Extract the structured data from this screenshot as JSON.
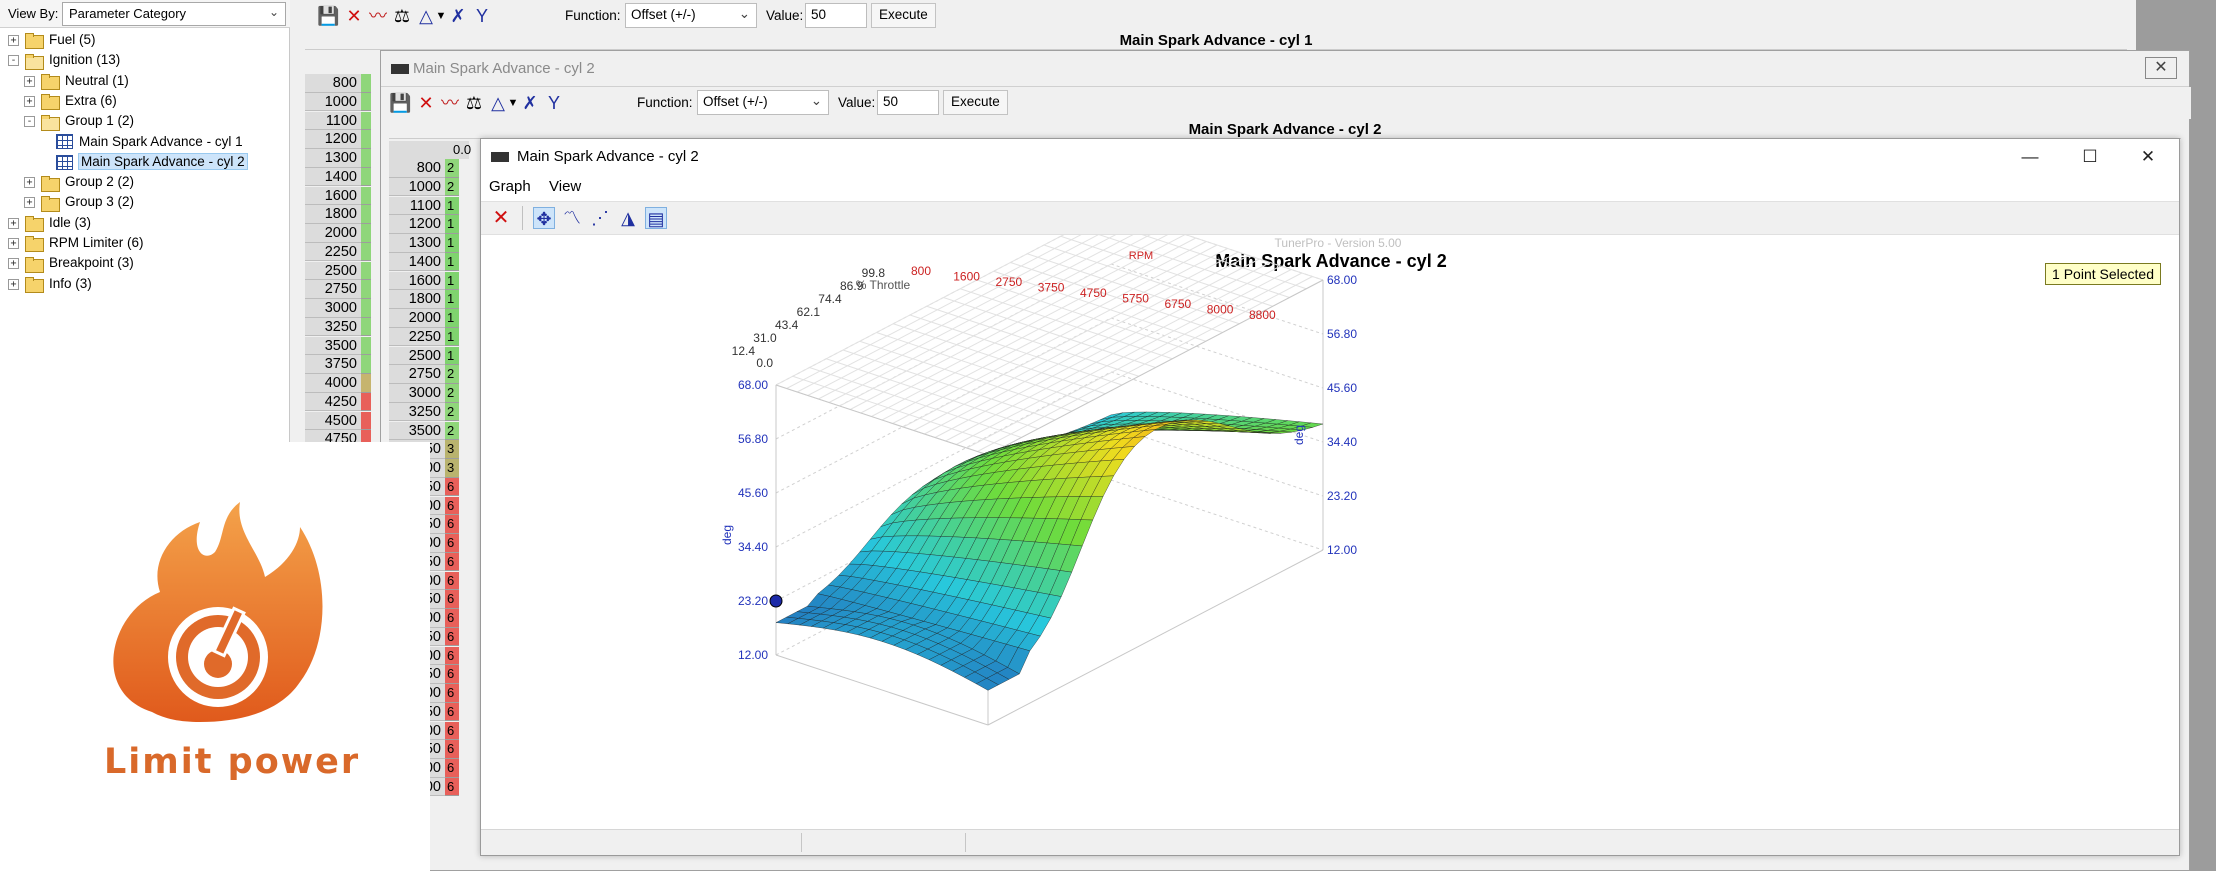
{
  "sidebar": {
    "view_by_label": "View By:",
    "view_by_value": "Parameter Category",
    "tree": [
      {
        "label": "Fuel (5)",
        "level": 0,
        "exp": "+",
        "icon": "folder"
      },
      {
        "label": "Ignition (13)",
        "level": 0,
        "exp": "-",
        "icon": "folder-open"
      },
      {
        "label": "Neutral (1)",
        "level": 1,
        "exp": "+",
        "icon": "folder"
      },
      {
        "label": "Extra (6)",
        "level": 1,
        "exp": "+",
        "icon": "folder"
      },
      {
        "label": "Group 1 (2)",
        "level": 1,
        "exp": "-",
        "icon": "folder-open"
      },
      {
        "label": "Main Spark Advance - cyl 1",
        "level": 2,
        "exp": "",
        "icon": "table"
      },
      {
        "label": "Main Spark Advance - cyl 2",
        "level": 2,
        "exp": "",
        "icon": "table",
        "selected": true
      },
      {
        "label": "Group 2 (2)",
        "level": 1,
        "exp": "+",
        "icon": "folder"
      },
      {
        "label": "Group 3 (2)",
        "level": 1,
        "exp": "+",
        "icon": "folder"
      },
      {
        "label": "Idle (3)",
        "level": 0,
        "exp": "+",
        "icon": "folder"
      },
      {
        "label": "RPM Limiter (6)",
        "level": 0,
        "exp": "+",
        "icon": "folder"
      },
      {
        "label": "Breakpoint (3)",
        "level": 0,
        "exp": "+",
        "icon": "folder"
      },
      {
        "label": "Info (3)",
        "level": 0,
        "exp": "+",
        "icon": "folder"
      }
    ]
  },
  "logo": {
    "text": "Limit power",
    "color": "#d9692a"
  },
  "table_window_1": {
    "title": "Main Spark Advance - cyl 1",
    "function_label": "Function:",
    "function_value": "Offset (+/-)",
    "value_label": "Value:",
    "value": "50",
    "execute_label": "Execute",
    "rpm_rows": [
      "800",
      "1000",
      "1100",
      "1200",
      "1300",
      "1400",
      "1600",
      "1800",
      "2000",
      "2250",
      "2500",
      "2750",
      "3000",
      "3250",
      "3500",
      "3750",
      "4000",
      "4250",
      "4500",
      "4750"
    ]
  },
  "table_window_2": {
    "title": "Main Spark Advance - cyl 2",
    "function_label": "Function:",
    "function_value": "Offset (+/-)",
    "value_label": "Value:",
    "value": "50",
    "execute_label": "Execute",
    "col_header": "0.0",
    "rpm_rows": [
      "800",
      "1000",
      "1100",
      "1200",
      "1300",
      "1400",
      "1600",
      "1800",
      "2000",
      "2250",
      "2500",
      "2750",
      "3000",
      "3250",
      "3500"
    ],
    "row_cells": [
      "2",
      "2",
      "1",
      "1",
      "1",
      "1",
      "1",
      "1",
      "1",
      "1",
      "1",
      "2",
      "2",
      "2",
      "2",
      "3",
      "3",
      "6",
      "6",
      "6",
      "6",
      "6",
      "6",
      "6",
      "6",
      "6",
      "6",
      "6",
      "6",
      "6",
      "6",
      "6",
      "6",
      "6"
    ],
    "cut_rows": [
      "50",
      "00",
      "50",
      "00",
      "50",
      "00",
      "50",
      "00",
      "50",
      "00",
      "50",
      "00",
      "50",
      "00",
      "50",
      "00",
      "50",
      "00",
      "00"
    ]
  },
  "graph_window": {
    "title": "Main Spark Advance - cyl 2",
    "menu": [
      "Graph",
      "View"
    ],
    "minimize": "—",
    "maximize": "☐",
    "close": "✕",
    "status_selected": "1 Point Selected"
  },
  "chart_data": {
    "type": "surface3d",
    "title": "Main Spark Advance - cyl 2",
    "watermark": "TunerPro - Version 5.00",
    "x_axis_label": "% Throttle",
    "x_ticks": [
      "12.4",
      "31.0",
      "43.4",
      "62.1",
      "74.4",
      "86.9",
      "99.8"
    ],
    "x_tick_extra": "0.0",
    "y_axis_label": "RPM",
    "y_ticks": [
      "800",
      "1600",
      "2750",
      "3750",
      "4750",
      "5750",
      "6750",
      "8000",
      "8800"
    ],
    "z_axis_label": "deg",
    "z_ticks_left": [
      "12.00",
      "23.20",
      "34.40",
      "45.60",
      "56.80",
      "68.00"
    ],
    "z_ticks_right": [
      "12.00",
      "23.20",
      "34.40",
      "45.60",
      "56.80",
      "68.00"
    ],
    "z_range": [
      12.0,
      68.0
    ],
    "colors": {
      "axis_x": "#333333",
      "axis_y": "#cc2222",
      "axis_z": "#2233bb",
      "surface_low": "#1f3aa8",
      "surface_high": "#d82818"
    },
    "grid": true
  }
}
